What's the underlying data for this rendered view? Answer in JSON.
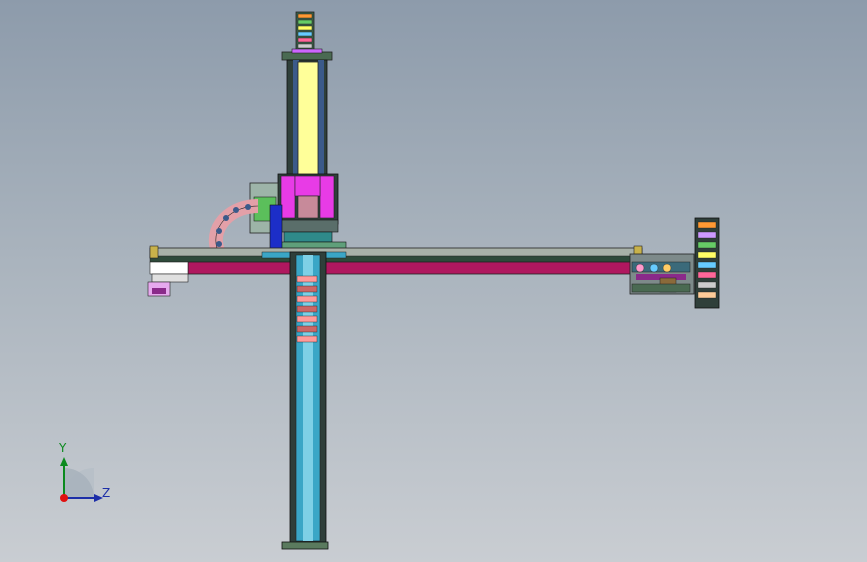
{
  "viewport": {
    "background_top": "#8d9bab",
    "background_bottom": "#c9cdd2"
  },
  "model": {
    "description_colors": {
      "yellow_column": "#ffff99",
      "magenta_beam": "#b0175f",
      "cyan_rail": "#3aa6c6",
      "pink_block": "#e83be6",
      "blue_block": "#1c2ec8",
      "green_base": "#5a7a5e"
    }
  },
  "triad": {
    "y_label": "Y",
    "z_label": "Z",
    "y_color": "#0b8a1e",
    "z_color": "#1c2ea8",
    "origin_color": "#e01010"
  }
}
